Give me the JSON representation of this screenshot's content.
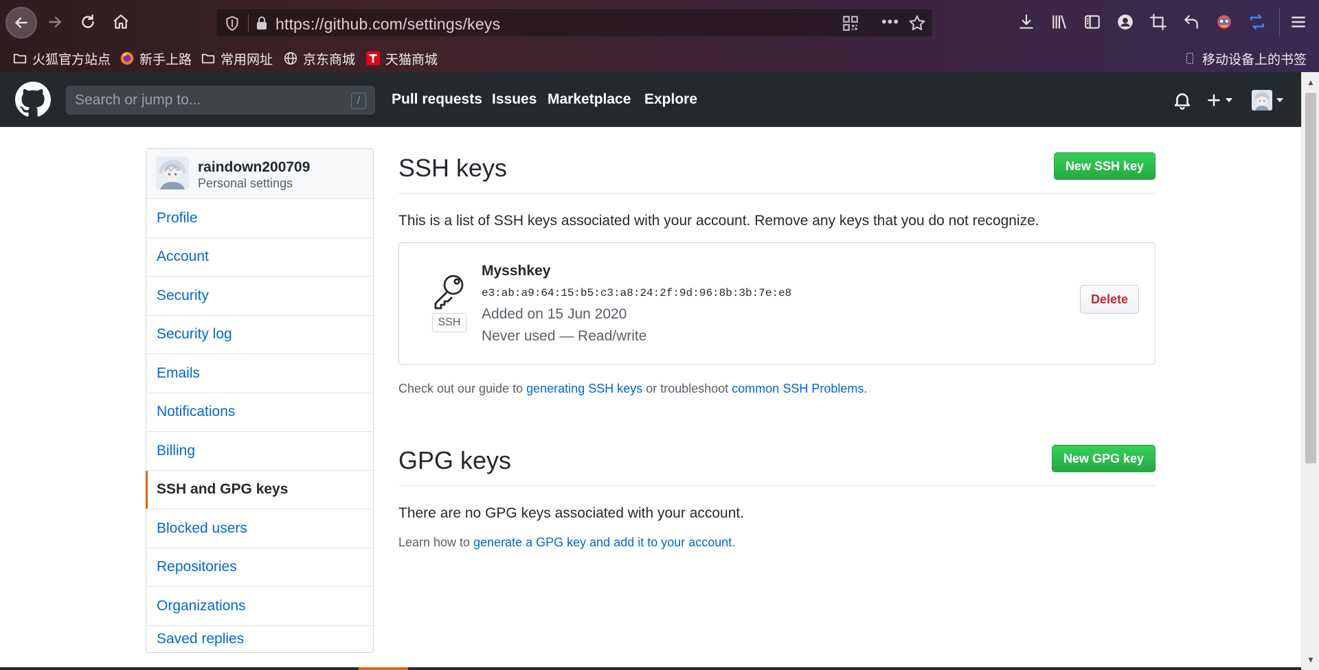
{
  "browser": {
    "url": "https://github.com/settings/keys",
    "bookmarks": [
      {
        "label": "火狐官方站点",
        "icon": "folder-icon"
      },
      {
        "label": "新手上路",
        "icon": "firefox-icon"
      },
      {
        "label": "常用网址",
        "icon": "folder-icon"
      },
      {
        "label": "京东商城",
        "icon": "globe-icon"
      },
      {
        "label": "天猫商城",
        "icon": "tmall-icon"
      }
    ],
    "mobile_bookmarks": "移动设备上的书签"
  },
  "github": {
    "search_placeholder": "Search or jump to...",
    "search_shortcut": "/",
    "nav": [
      "Pull requests",
      "Issues",
      "Marketplace",
      "Explore"
    ]
  },
  "sidebar": {
    "username": "raindown200709",
    "subtitle": "Personal settings",
    "items": [
      {
        "label": "Profile",
        "selected": false
      },
      {
        "label": "Account",
        "selected": false
      },
      {
        "label": "Security",
        "selected": false
      },
      {
        "label": "Security log",
        "selected": false
      },
      {
        "label": "Emails",
        "selected": false
      },
      {
        "label": "Notifications",
        "selected": false
      },
      {
        "label": "Billing",
        "selected": false
      },
      {
        "label": "SSH and GPG keys",
        "selected": true
      },
      {
        "label": "Blocked users",
        "selected": false
      },
      {
        "label": "Repositories",
        "selected": false
      },
      {
        "label": "Organizations",
        "selected": false
      },
      {
        "label": "Saved replies",
        "selected": false
      }
    ]
  },
  "ssh": {
    "title": "SSH keys",
    "new_button": "New SSH key",
    "intro": "This is a list of SSH keys associated with your account. Remove any keys that you do not recognize.",
    "key": {
      "name": "Mysshkey",
      "badge": "SSH",
      "fingerprint": "e3:ab:a9:64:15:b5:c3:a8:24:2f:9d:96:8b:3b:7e:e8",
      "added": "Added on 15 Jun 2020",
      "usage": "Never used — Read/write",
      "delete_label": "Delete"
    },
    "help_prefix": "Check out our guide to ",
    "help_link1": "generating SSH keys",
    "help_middle": " or troubleshoot ",
    "help_link2": "common SSH Problems",
    "help_suffix": "."
  },
  "gpg": {
    "title": "GPG keys",
    "new_button": "New GPG key",
    "empty": "There are no GPG keys associated with your account.",
    "help_prefix": "Learn how to ",
    "help_link": "generate a GPG key and add it to your account",
    "help_suffix": "."
  },
  "colors": {
    "github_header": "#24292e",
    "link": "#0366d6",
    "green_button": "#28a745",
    "danger": "#cb2431",
    "selected_marker": "#e36209"
  }
}
